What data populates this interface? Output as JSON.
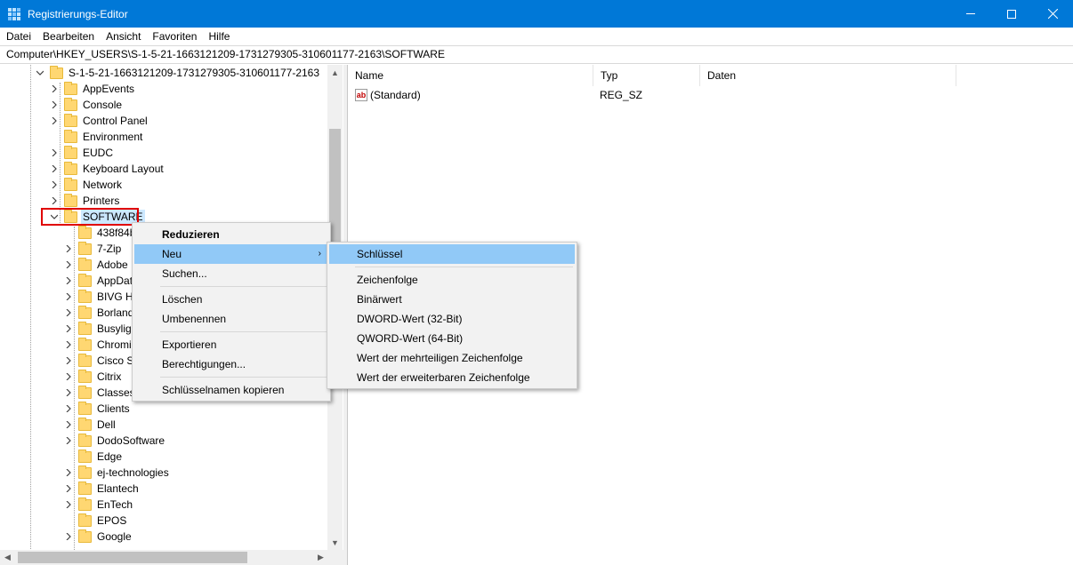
{
  "window": {
    "title": "Registrierungs-Editor"
  },
  "menu": [
    "Datei",
    "Bearbeiten",
    "Ansicht",
    "Favoriten",
    "Hilfe"
  ],
  "address": "Computer\\HKEY_USERS\\S-1-5-21-1663121209-1731279305-310601177-2163\\SOFTWARE",
  "tree": {
    "root": "S-1-5-21-1663121209-1731279305-310601177-2163",
    "children": [
      "AppEvents",
      "Console",
      "Control Panel",
      "Environment",
      "EUDC",
      "Keyboard Layout",
      "Network",
      "Printers",
      "SOFTWARE"
    ],
    "children_expandable": [
      true,
      true,
      true,
      false,
      true,
      true,
      true,
      true,
      true
    ],
    "selected": "SOFTWARE",
    "software_children": [
      "438f84b",
      "7-Zip",
      "Adobe",
      "AppDat",
      "BIVG Ha",
      "Borland",
      "Busyligh",
      "Chromi",
      "Cisco Sy",
      "Citrix",
      "Classes",
      "Clients",
      "Dell",
      "DodoSoftware",
      "Edge",
      "ej-technologies",
      "Elantech",
      "EnTech",
      "EPOS",
      "Google"
    ],
    "software_children_expandable": [
      false,
      true,
      true,
      true,
      true,
      true,
      true,
      true,
      true,
      true,
      true,
      true,
      true,
      true,
      false,
      true,
      true,
      true,
      false,
      true
    ]
  },
  "list": {
    "columns": [
      "Name",
      "Typ",
      "Daten"
    ],
    "rows": [
      {
        "name": "(Standard)",
        "type": "REG_SZ",
        "data": ""
      }
    ]
  },
  "context_menu": {
    "items": [
      "Reduzieren",
      "Neu",
      "Suchen...",
      "Löschen",
      "Umbenennen",
      "Exportieren",
      "Berechtigungen...",
      "Schlüsselnamen kopieren"
    ]
  },
  "submenu": {
    "items": [
      "Schlüssel",
      "Zeichenfolge",
      "Binärwert",
      "DWORD-Wert (32-Bit)",
      "QWORD-Wert (64-Bit)",
      "Wert der mehrteiligen Zeichenfolge",
      "Wert der erweiterbaren Zeichenfolge"
    ]
  },
  "colors": {
    "titlebar": "#0078d7",
    "highlight": "#91c9f7",
    "selection": "#cce8ff",
    "annotation": "#e00000"
  }
}
